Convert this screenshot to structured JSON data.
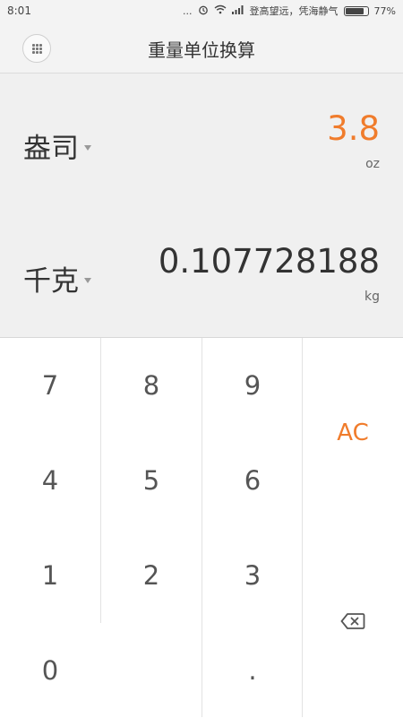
{
  "status_bar": {
    "time": "8:01",
    "dots": "...",
    "carrier_text": "登高望远，凭海静气",
    "battery": "77%"
  },
  "header": {
    "title": "重量单位换算",
    "menu_icon": "grid-menu-icon"
  },
  "converter": {
    "from": {
      "unit_name": "盎司",
      "value": "3.8",
      "unit_abbr": "oz"
    },
    "to": {
      "unit_name": "千克",
      "value": "0.107728188",
      "unit_abbr": "kg"
    },
    "active_color": "#f07c2c"
  },
  "keypad": {
    "keys": {
      "k7": "7",
      "k8": "8",
      "k9": "9",
      "k4": "4",
      "k5": "5",
      "k6": "6",
      "k1": "1",
      "k2": "2",
      "k3": "3",
      "k0": "0",
      "dot": "."
    },
    "clear_label": "AC",
    "backspace_icon": "backspace-icon"
  }
}
